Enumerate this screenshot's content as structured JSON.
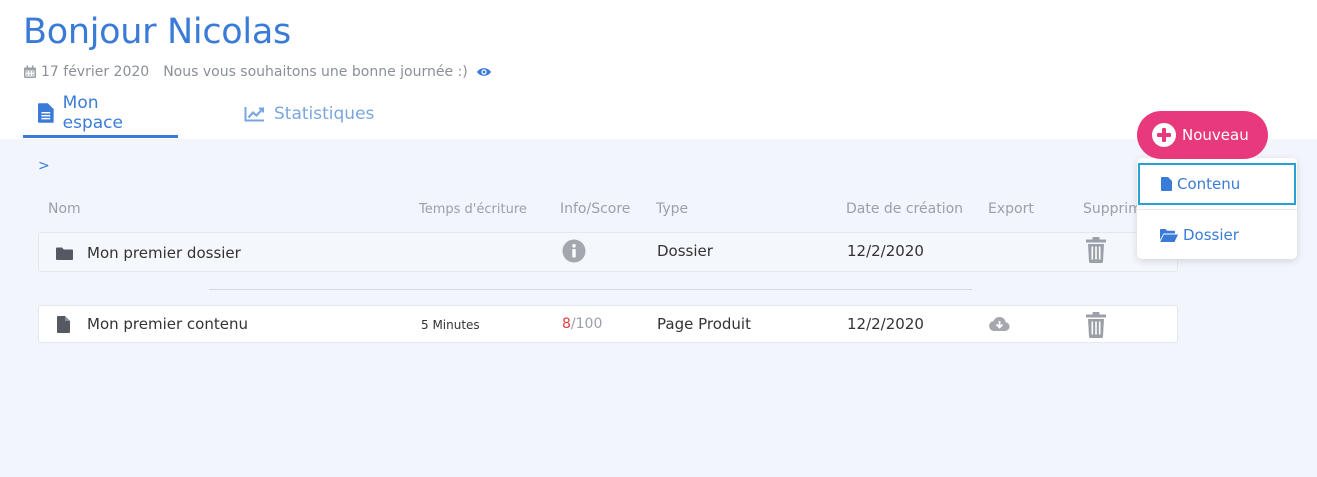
{
  "header": {
    "greeting": "Bonjour Nicolas",
    "date": "17 février 2020",
    "message": "Nous vous souhaitons une bonne journée :)"
  },
  "tabs": [
    {
      "label": "Mon espace",
      "icon": "document-icon",
      "active": true
    },
    {
      "label": "Statistiques",
      "icon": "chart-icon",
      "active": false
    }
  ],
  "breadcrumb": ">",
  "table": {
    "columns": [
      "Nom",
      "Temps d'écriture",
      "Info/Score",
      "Type",
      "Date de création",
      "Export",
      "Supprim"
    ],
    "rows": [
      {
        "kind": "folder",
        "name": "Mon premier dossier",
        "time": "",
        "type": "Dossier",
        "date": "12/2/2020"
      },
      {
        "kind": "content",
        "name": "Mon premier contenu",
        "time": "5 Minutes",
        "score": "8",
        "score_max": "/100",
        "type": "Page Produit",
        "date": "12/2/2020"
      }
    ]
  },
  "new_button": {
    "label": "Nouveau",
    "menu": [
      {
        "label": "Contenu",
        "icon": "file-icon"
      },
      {
        "label": "Dossier",
        "icon": "folder-open-icon"
      }
    ]
  },
  "colors": {
    "primary": "#3b7bd8",
    "accent": "#e8397d",
    "workspace_bg": "#f2f6fc",
    "score_low": "#e04040",
    "focus_border": "#2a9fd6"
  }
}
